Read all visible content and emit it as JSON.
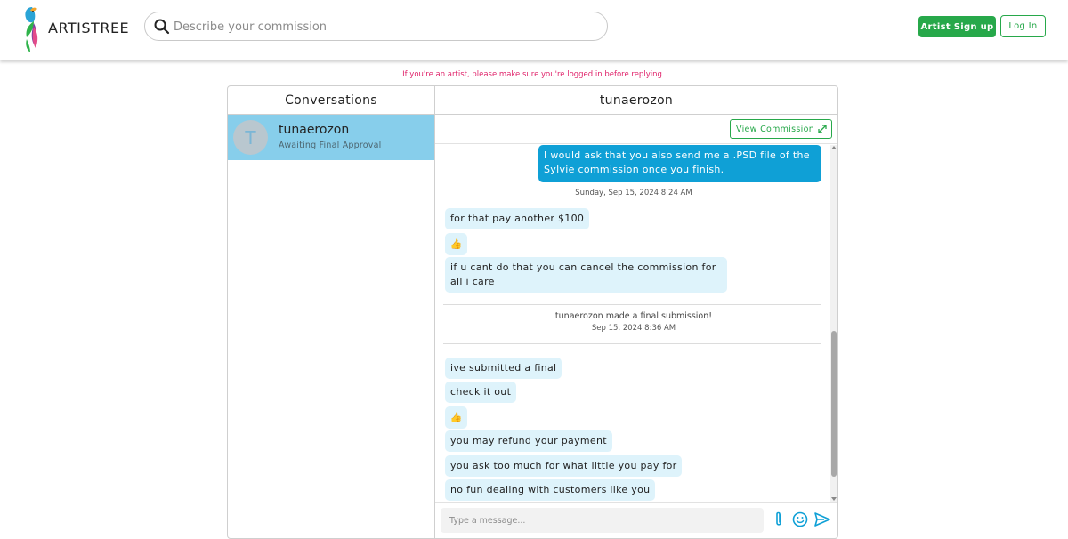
{
  "header": {
    "brand": "ARTISTREE",
    "search_placeholder": "Describe your commission",
    "signup_label": "Artist Sign up",
    "login_label": "Log In"
  },
  "notice": "If you're an artist, please make sure you're logged in before replying",
  "conversations": {
    "title": "Conversations",
    "items": [
      {
        "avatar_letter": "T",
        "name": "tunaerozon",
        "status": "Awaiting Final Approval"
      }
    ]
  },
  "chat": {
    "title": "tunaerozon",
    "view_commission_label": "View Commission",
    "messages": {
      "m1": "I would ask that you also send me a .PSD file of the Sylvie commission once you finish.",
      "ts1": "Sunday, Sep 15, 2024 8:24 AM",
      "m2": "for that pay another $100",
      "m3": "👍",
      "m4": "if u cant do that you can cancel the commission for all i care",
      "sys": "tunaerozon made a final submission!",
      "sys_ts": "Sep 15, 2024 8:36 AM",
      "m5": "ive submitted a final",
      "m6": "check it out",
      "m7": "👍",
      "m8": "you may refund your payment",
      "m9": "you ask too much for what little you pay for",
      "m10": "no fun dealing with customers like you"
    },
    "input_placeholder": "Type a message..."
  },
  "colors": {
    "brand_green": "#27a84a",
    "notice_pink": "#e0246b",
    "outgoing_bubble": "#0fa0d6",
    "incoming_bubble": "#def3fb",
    "selected_conversation": "#87ceeb",
    "icon_blue": "#0fa0d6"
  }
}
